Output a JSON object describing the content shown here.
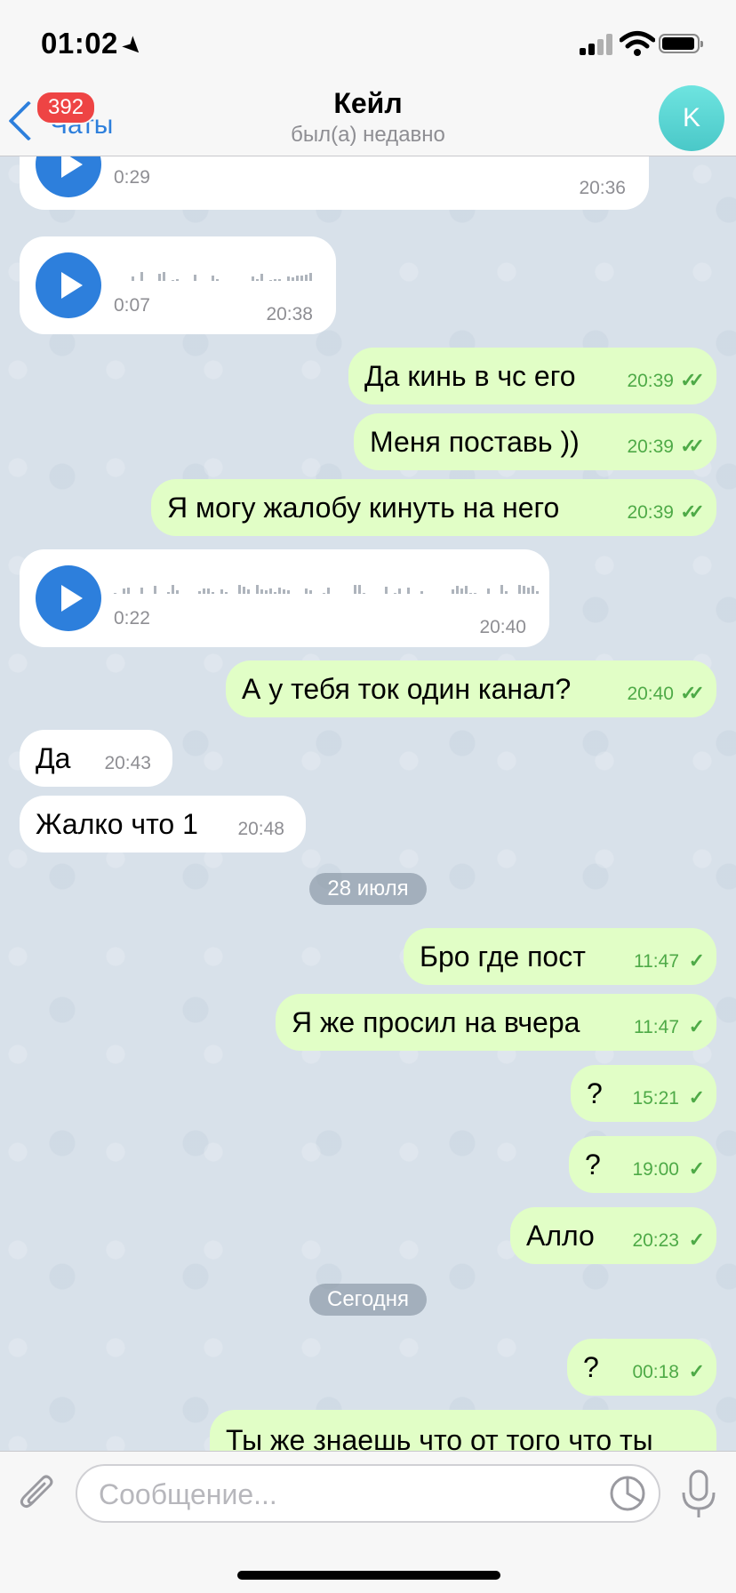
{
  "status": {
    "time": "01:02"
  },
  "header": {
    "back_label": "Чаты",
    "unread_badge": "392",
    "title": "Кейл",
    "subtitle": "был(а) недавно",
    "avatar_letter": "K"
  },
  "messages": [
    {
      "type": "voice",
      "dir": "in",
      "duration": "0:29",
      "time": "20:36"
    },
    {
      "type": "voice",
      "dir": "in",
      "duration": "0:07",
      "time": "20:38"
    },
    {
      "type": "text",
      "dir": "out",
      "text": "Да кинь в чс его",
      "time": "20:39",
      "read": true
    },
    {
      "type": "text",
      "dir": "out",
      "text": "Меня поставь ))",
      "time": "20:39",
      "read": true
    },
    {
      "type": "text",
      "dir": "out",
      "text": "Я могу жалобу кинуть на него",
      "time": "20:39",
      "read": true
    },
    {
      "type": "voice",
      "dir": "in",
      "duration": "0:22",
      "time": "20:40"
    },
    {
      "type": "text",
      "dir": "out",
      "text": "А у тебя ток один канал?",
      "time": "20:40",
      "read": true
    },
    {
      "type": "text",
      "dir": "in",
      "text": "Да",
      "time": "20:43"
    },
    {
      "type": "text",
      "dir": "in",
      "text": "Жалко что 1",
      "time": "20:48"
    },
    {
      "type": "date",
      "text": "28 июля"
    },
    {
      "type": "text",
      "dir": "out",
      "text": "Бро где пост",
      "time": "11:47",
      "read": false
    },
    {
      "type": "text",
      "dir": "out",
      "text": "Я же просил на вчера",
      "time": "11:47",
      "read": false
    },
    {
      "type": "text",
      "dir": "out",
      "text": "?",
      "time": "15:21",
      "read": false
    },
    {
      "type": "text",
      "dir": "out",
      "text": "?",
      "time": "19:00",
      "read": false
    },
    {
      "type": "text",
      "dir": "out",
      "text": "Алло",
      "time": "20:23",
      "read": false
    },
    {
      "type": "date",
      "text": "Сегодня"
    },
    {
      "type": "text",
      "dir": "out",
      "text": "?",
      "time": "00:18",
      "read": false
    },
    {
      "type": "text",
      "dir": "out",
      "text": "Ты же знаешь что от того что ты",
      "time": "",
      "read": false
    }
  ],
  "composer": {
    "placeholder": "Сообщение..."
  },
  "icons": [
    "location-arrow-icon",
    "signal-icon",
    "wifi-icon",
    "battery-icon",
    "chevron-left-icon",
    "play-icon",
    "double-check-icon",
    "check-icon",
    "paperclip-icon",
    "sticker-icon",
    "microphone-icon"
  ],
  "colors": {
    "accent": "#2d7fdc",
    "outgoing_bubble": "#e1fec6",
    "incoming_bubble": "#ffffff",
    "read_check": "#4eaa47",
    "badge": "#ee4444",
    "avatar": "#5bd6d4"
  }
}
